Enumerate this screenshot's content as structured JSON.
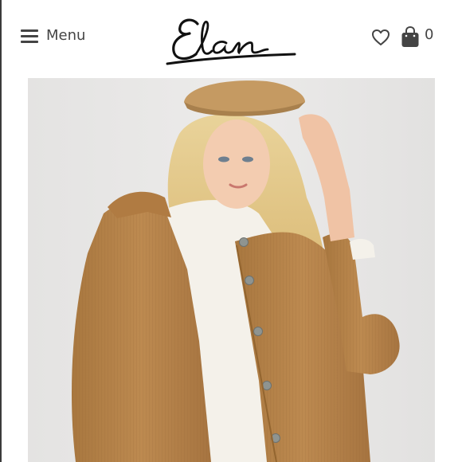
{
  "header": {
    "menu_label": "Menu",
    "logo_text": "Elan",
    "cart_count": "0"
  },
  "icons": {
    "menu": "hamburger-icon",
    "wishlist": "heart-icon",
    "cart": "shopping-bag-icon"
  },
  "colors": {
    "text": "#444444",
    "jacket": "#b5834a",
    "sweater": "#f4f1ea",
    "hat": "#c59a62",
    "background": "#e8e7e6"
  }
}
